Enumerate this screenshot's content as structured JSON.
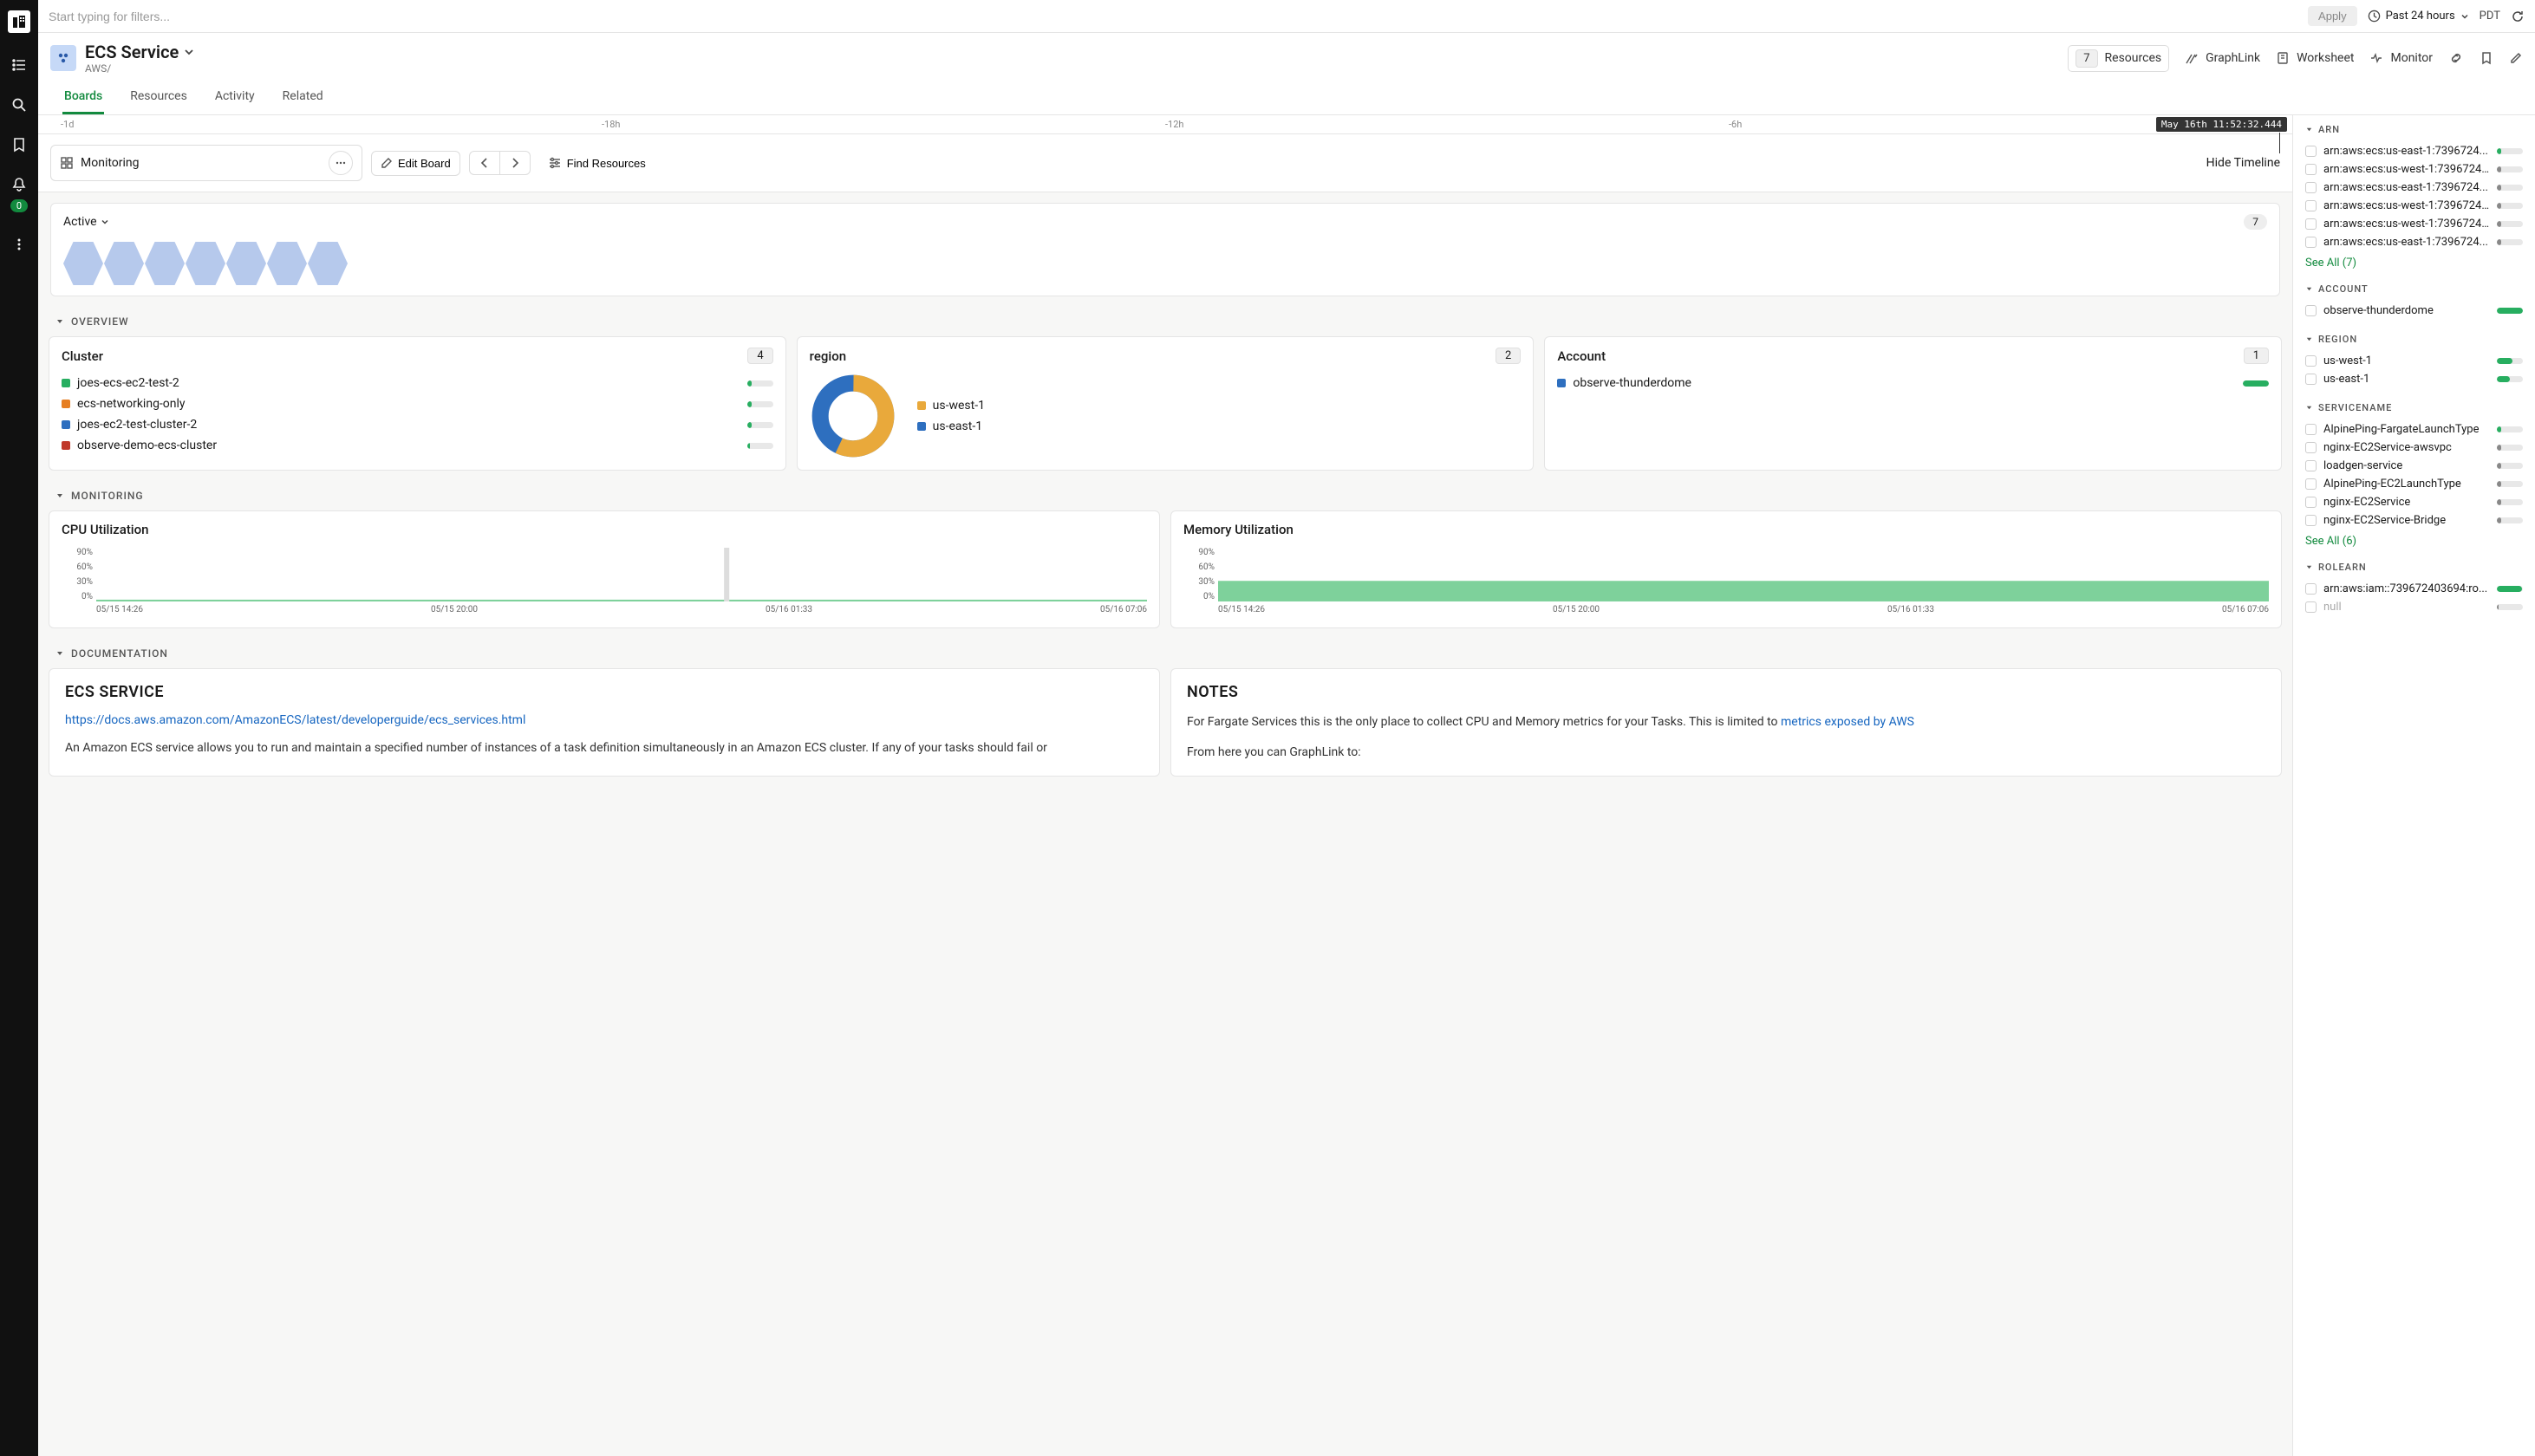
{
  "filter": {
    "placeholder": "Start typing for filters...",
    "apply": "Apply",
    "time_range": "Past 24 hours",
    "tz": "PDT"
  },
  "header": {
    "title": "ECS Service",
    "breadcrumb": "AWS/",
    "resources_count": "7",
    "resources_label": "Resources",
    "graphlink": "GraphLink",
    "worksheet": "Worksheet",
    "monitor": "Monitor"
  },
  "nav_badge": "0",
  "tabs": {
    "boards": "Boards",
    "resources": "Resources",
    "activity": "Activity",
    "related": "Related"
  },
  "timeline": {
    "ticks": [
      "-1d",
      "-18h",
      "-12h",
      "-6h"
    ],
    "timestamp": "May 16th 11:52:32.444"
  },
  "toolbar": {
    "monitoring": "Monitoring",
    "edit": "Edit Board",
    "find": "Find Resources",
    "hide": "Hide Timeline"
  },
  "active": {
    "label": "Active",
    "count": "7",
    "hex_count": 7
  },
  "sections": {
    "overview": "OVERVIEW",
    "monitoring": "MONITORING",
    "documentation": "DOCUMENTATION"
  },
  "overview": {
    "cluster": {
      "title": "Cluster",
      "count": "4",
      "items": [
        {
          "label": "joes-ecs-ec2-test-2",
          "color": "#27ae60",
          "fill": 18
        },
        {
          "label": "ecs-networking-only",
          "color": "#e67e22",
          "fill": 18
        },
        {
          "label": "joes-ec2-test-cluster-2",
          "color": "#2e6fbf",
          "fill": 18
        },
        {
          "label": "observe-demo-ecs-cluster",
          "color": "#c0392b",
          "fill": 10
        }
      ]
    },
    "region": {
      "title": "region",
      "count": "2",
      "items": [
        {
          "label": "us-west-1",
          "color": "#e9a93b"
        },
        {
          "label": "us-east-1",
          "color": "#2e6fbf"
        }
      ]
    },
    "account": {
      "title": "Account",
      "count": "1",
      "items": [
        {
          "label": "observe-thunderdome",
          "color": "#2e6fbf",
          "fill": 100
        }
      ]
    }
  },
  "chart_data": [
    {
      "type": "pie",
      "title": "region",
      "series": [
        {
          "name": "us-west-1",
          "value": 57,
          "color": "#e9a93b"
        },
        {
          "name": "us-east-1",
          "value": 43,
          "color": "#2e6fbf"
        }
      ]
    },
    {
      "type": "area",
      "title": "CPU Utilization",
      "ylabel": "%",
      "ylim": [
        0,
        90
      ],
      "yticks": [
        "90%",
        "60%",
        "30%",
        "0%"
      ],
      "xticks": [
        "05/15 14:26",
        "05/15 20:00",
        "05/16 01:33",
        "05/16 07:06"
      ],
      "approx_value": 2
    },
    {
      "type": "area",
      "title": "Memory Utilization",
      "ylabel": "%",
      "ylim": [
        0,
        90
      ],
      "yticks": [
        "90%",
        "60%",
        "30%",
        "0%"
      ],
      "xticks": [
        "05/15 14:26",
        "05/15 20:00",
        "05/16 01:33",
        "05/16 07:06"
      ],
      "approx_value": 35
    }
  ],
  "monitoring": {
    "cpu": {
      "title": "CPU Utilization"
    },
    "mem": {
      "title": "Memory Utilization"
    }
  },
  "documentation": {
    "ecs": {
      "title": "ECS SERVICE",
      "link": "https://docs.aws.amazon.com/AmazonECS/latest/developerguide/ecs_services.html",
      "text": "An Amazon ECS service allows you to run and maintain a specified number of instances of a task definition simultaneously in an Amazon ECS cluster. If any of your tasks should fail or"
    },
    "notes": {
      "title": "NOTES",
      "p1a": "For Fargate Services this is the only place to collect CPU and Memory metrics for your Tasks. This is limited to ",
      "p1link": "metrics exposed by AWS",
      "p2": "From here you can GraphLink to:"
    }
  },
  "side": {
    "arn": {
      "title": "ARN",
      "items": [
        {
          "txt": "arn:aws:ecs:us-east-1:7396724...",
          "fill": 18,
          "color": "#27ae60"
        },
        {
          "txt": "arn:aws:ecs:us-west-1:7396724...",
          "fill": 18,
          "color": "#888"
        },
        {
          "txt": "arn:aws:ecs:us-east-1:7396724...",
          "fill": 18,
          "color": "#888"
        },
        {
          "txt": "arn:aws:ecs:us-west-1:7396724...",
          "fill": 18,
          "color": "#888"
        },
        {
          "txt": "arn:aws:ecs:us-west-1:7396724...",
          "fill": 18,
          "color": "#888"
        },
        {
          "txt": "arn:aws:ecs:us-east-1:7396724...",
          "fill": 18,
          "color": "#888"
        }
      ],
      "see_all": "See All (7)"
    },
    "account": {
      "title": "ACCOUNT",
      "items": [
        {
          "txt": "observe-thunderdome",
          "fill": 100,
          "color": "#27ae60"
        }
      ]
    },
    "region": {
      "title": "REGION",
      "items": [
        {
          "txt": "us-west-1",
          "fill": 60,
          "color": "#27ae60"
        },
        {
          "txt": "us-east-1",
          "fill": 50,
          "color": "#27ae60"
        }
      ]
    },
    "servicename": {
      "title": "SERVICENAME",
      "items": [
        {
          "txt": "AlpinePing-FargateLaunchType",
          "fill": 18,
          "color": "#27ae60"
        },
        {
          "txt": "nginx-EC2Service-awsvpc",
          "fill": 18,
          "color": "#888"
        },
        {
          "txt": "loadgen-service",
          "fill": 18,
          "color": "#888"
        },
        {
          "txt": "AlpinePing-EC2LaunchType",
          "fill": 18,
          "color": "#888"
        },
        {
          "txt": "nginx-EC2Service",
          "fill": 18,
          "color": "#888"
        },
        {
          "txt": "nginx-EC2Service-Bridge",
          "fill": 18,
          "color": "#888"
        }
      ],
      "see_all": "See All (6)"
    },
    "rolearn": {
      "title": "ROLEARN",
      "items": [
        {
          "txt": "arn:aws:iam::739672403694:ro...",
          "fill": 95,
          "color": "#27ae60"
        },
        {
          "txt": "null",
          "fill": 8,
          "color": "#888",
          "null": true
        }
      ]
    }
  }
}
